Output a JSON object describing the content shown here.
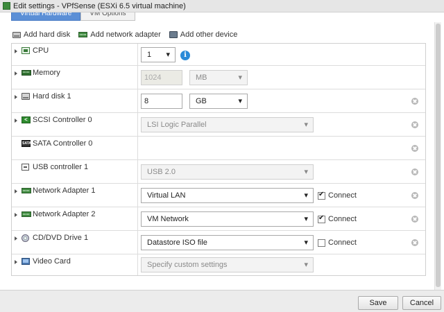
{
  "window": {
    "title": "Edit settings - VPfSense (ESXi 6.5 virtual machine)"
  },
  "tabs": [
    {
      "label": "Virtual Hardware",
      "active": true
    },
    {
      "label": "VM Options",
      "active": false
    }
  ],
  "toolbar": {
    "add_hard_disk": "Add hard disk",
    "add_network_adapter": "Add network adapter",
    "add_other_device": "Add other device"
  },
  "devices": {
    "cpu": {
      "label": "CPU",
      "value": "1",
      "info_icon": "info-icon"
    },
    "memory": {
      "label": "Memory",
      "value": "1024",
      "unit": "MB"
    },
    "hard_disk_1": {
      "label": "Hard disk 1",
      "value": "8",
      "unit": "GB"
    },
    "scsi_controller_0": {
      "label": "SCSI Controller 0",
      "value": "LSI Logic Parallel"
    },
    "sata_controller_0": {
      "label": "SATA Controller 0"
    },
    "usb_controller_1": {
      "label": "USB controller 1",
      "value": "USB 2.0"
    },
    "network_adapter_1": {
      "label": "Network Adapter 1",
      "value": "Virtual LAN",
      "connect_label": "Connect",
      "connected": true
    },
    "network_adapter_2": {
      "label": "Network Adapter 2",
      "value": "VM Network",
      "connect_label": "Connect",
      "connected": true
    },
    "cd_dvd_drive_1": {
      "label": "CD/DVD Drive 1",
      "value": "Datastore ISO file",
      "connect_label": "Connect",
      "connected": false
    },
    "video_card": {
      "label": "Video Card",
      "value": "Specify custom settings"
    }
  },
  "footer": {
    "save_label": "Save",
    "cancel_label": "Cancel"
  },
  "colors": {
    "accent": "#2b8bd8",
    "tab_active": "#5b8fd6",
    "nic_green": "#3f8a3f"
  }
}
